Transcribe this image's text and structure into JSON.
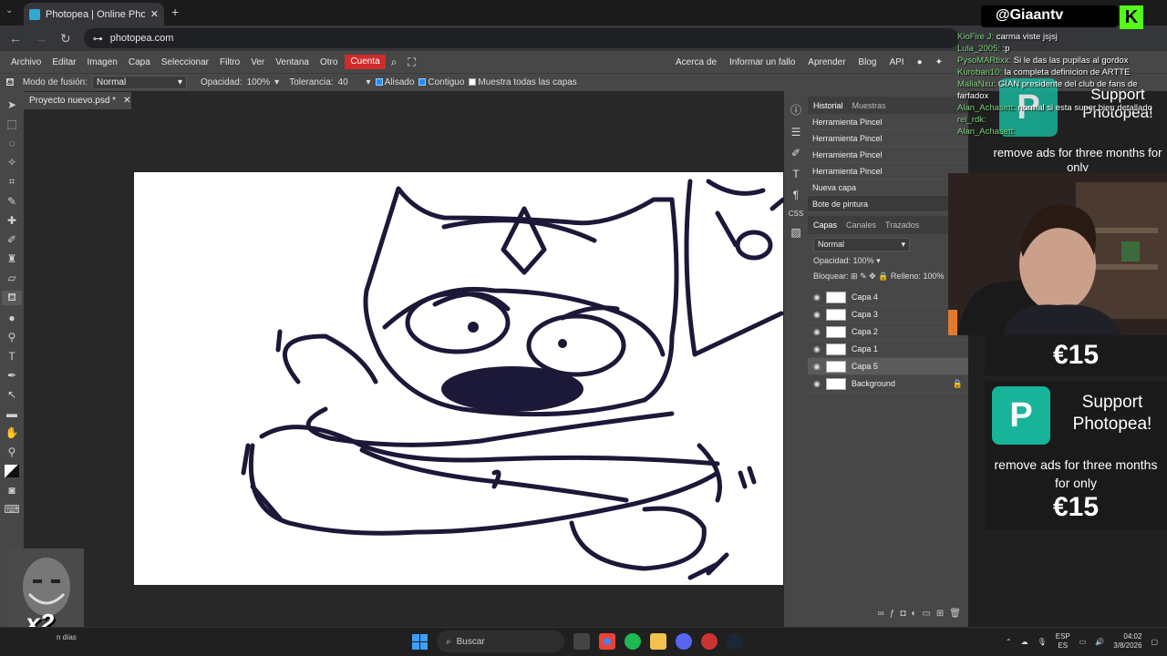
{
  "browser": {
    "tab_title": "Photopea | Online Photo Editor",
    "url": "photopea.com"
  },
  "menu": {
    "items": [
      "Archivo",
      "Editar",
      "Imagen",
      "Capa",
      "Seleccionar",
      "Filtro",
      "Ver",
      "Ventana",
      "Otro"
    ],
    "account": "Cuenta",
    "right_items": [
      "Acerca de",
      "Informar un fallo",
      "Aprender",
      "Blog",
      "API"
    ]
  },
  "options": {
    "blend_label": "Modo de fusión:",
    "blend_value": "Normal",
    "opacity_label": "Opacidad:",
    "opacity_value": "100%",
    "tolerance_label": "Tolerancia:",
    "tolerance_value": "40",
    "antialias_label": "Alisado",
    "contiguous_label": "Contiguo",
    "all_layers_label": "Muestra todas las capas"
  },
  "document": {
    "tab_name": "Proyecto nuevo.psd *"
  },
  "history": {
    "tabs": [
      "Historial",
      "Muestras"
    ],
    "items": [
      "Herramienta Pincel",
      "Herramienta Pincel",
      "Herramienta Pincel",
      "Herramienta Pincel",
      "Nueva capa",
      "Bote de pintura"
    ]
  },
  "layers": {
    "tabs": [
      "Capas",
      "Canales",
      "Trazados"
    ],
    "blend_value": "Normal",
    "opacity_label": "Opacidad:",
    "opacity_value": "100%",
    "lock_label": "Bloquear:",
    "fill_label": "Relleno:",
    "fill_value": "100%",
    "items": [
      {
        "name": "Capa 4",
        "selected": false
      },
      {
        "name": "Capa 3",
        "selected": false
      },
      {
        "name": "Capa 2",
        "selected": false
      },
      {
        "name": "Capa 1",
        "selected": false
      },
      {
        "name": "Capa 5",
        "selected": true
      },
      {
        "name": "Background",
        "selected": false
      }
    ]
  },
  "taskbar": {
    "search_placeholder": "Buscar",
    "lang_top": "ESP",
    "lang_bottom": "ES",
    "time": "04:02",
    "date": "3/8/2026",
    "weather": "n días"
  },
  "stream": {
    "handle": "@Giaantv",
    "chat": [
      {
        "user": "KioFire J:",
        "msg": "carma viste jsjsj"
      },
      {
        "user": "Lula_2005:",
        "msg": ":p"
      },
      {
        "user": "PysoMARtixx:",
        "msg": "Si le das las pupilas al gordox"
      },
      {
        "user": "Kuroban10:",
        "msg": "la completa definicion de ARTTE"
      },
      {
        "user": "MaliaNxu:",
        "msg": "GIAN presidente del club de fans de farfadox"
      },
      {
        "user": "Alan_Achasett:",
        "msg": "normal si esta super bien detallado"
      },
      {
        "user": "rei_rdk:",
        "msg": ""
      },
      {
        "user": "Alan_Achasett:",
        "msg": ""
      }
    ],
    "ad_title": "Support Photopea!",
    "ad_text": "remove ads for three months for only",
    "ad_text_top": "remove ads for three months for only",
    "ad_price": "€15",
    "multiplier": "x2"
  },
  "colors": {
    "accent": "#d02a2a",
    "ink": "#1b1838",
    "photopea_green": "#18b49a"
  }
}
